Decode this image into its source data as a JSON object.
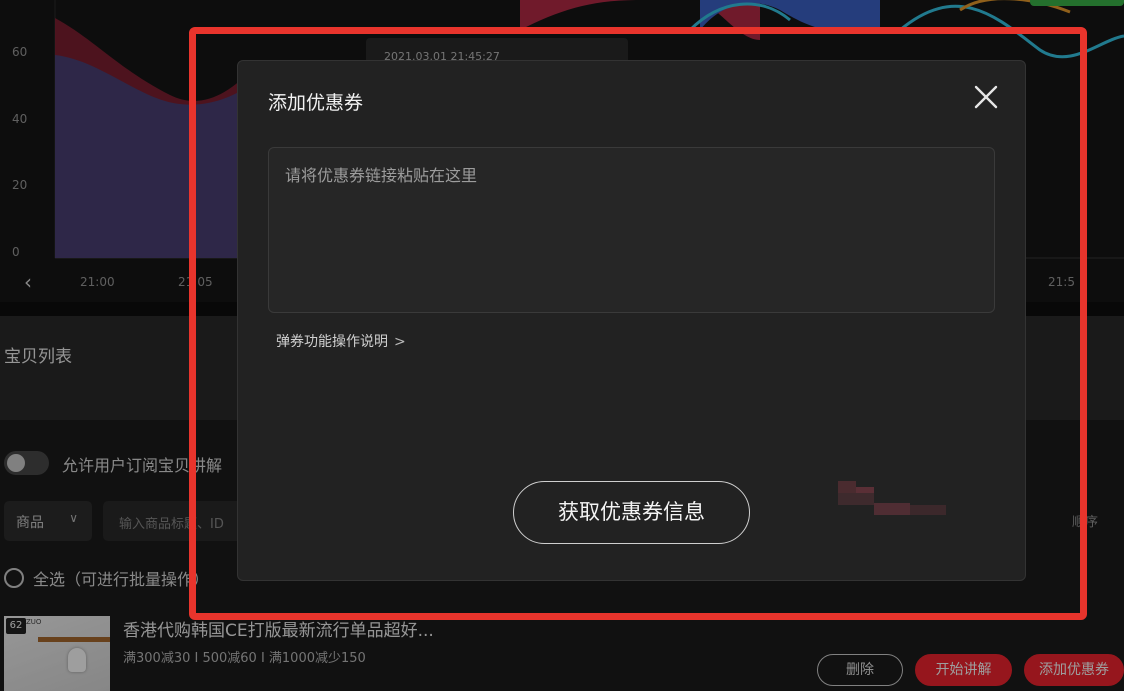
{
  "chart": {
    "y_ticks": [
      "60",
      "40",
      "20",
      "0"
    ],
    "x_ticks": [
      "21:00",
      "21:05",
      "21:5"
    ],
    "tooltip_text": "2021.03.01 21:45:27",
    "colors": {
      "red": "#d8273f",
      "blue": "#3d63c8",
      "cyan": "#36c6e6",
      "green": "#3ab54a",
      "orange": "#e89b2c"
    }
  },
  "list": {
    "title": "宝贝列表",
    "subscribe_label": "允许用户订阅宝贝讲解",
    "type_select": "商品",
    "search_placeholder": "输入商品标题、ID",
    "order_label": "顺序",
    "select_all": "全选（可进行批量操作）"
  },
  "product": {
    "index": "62",
    "thumb_brand": "ZUO",
    "title": "香港代购韩国CE打版最新流行单品超好...",
    "discount": "满300减30 I 500减60 I 满1000减少150",
    "buttons": {
      "delete": "删除",
      "start": "开始讲解",
      "add_coupon": "添加优惠券"
    }
  },
  "modal": {
    "title": "添加优惠券",
    "input_placeholder": "请将优惠券链接粘贴在这里",
    "input_value": "",
    "help_link": "弹券功能操作说明",
    "fetch_button": "获取优惠券信息"
  },
  "accent": {
    "red": "#f2242f",
    "frame": "#e8342c"
  }
}
